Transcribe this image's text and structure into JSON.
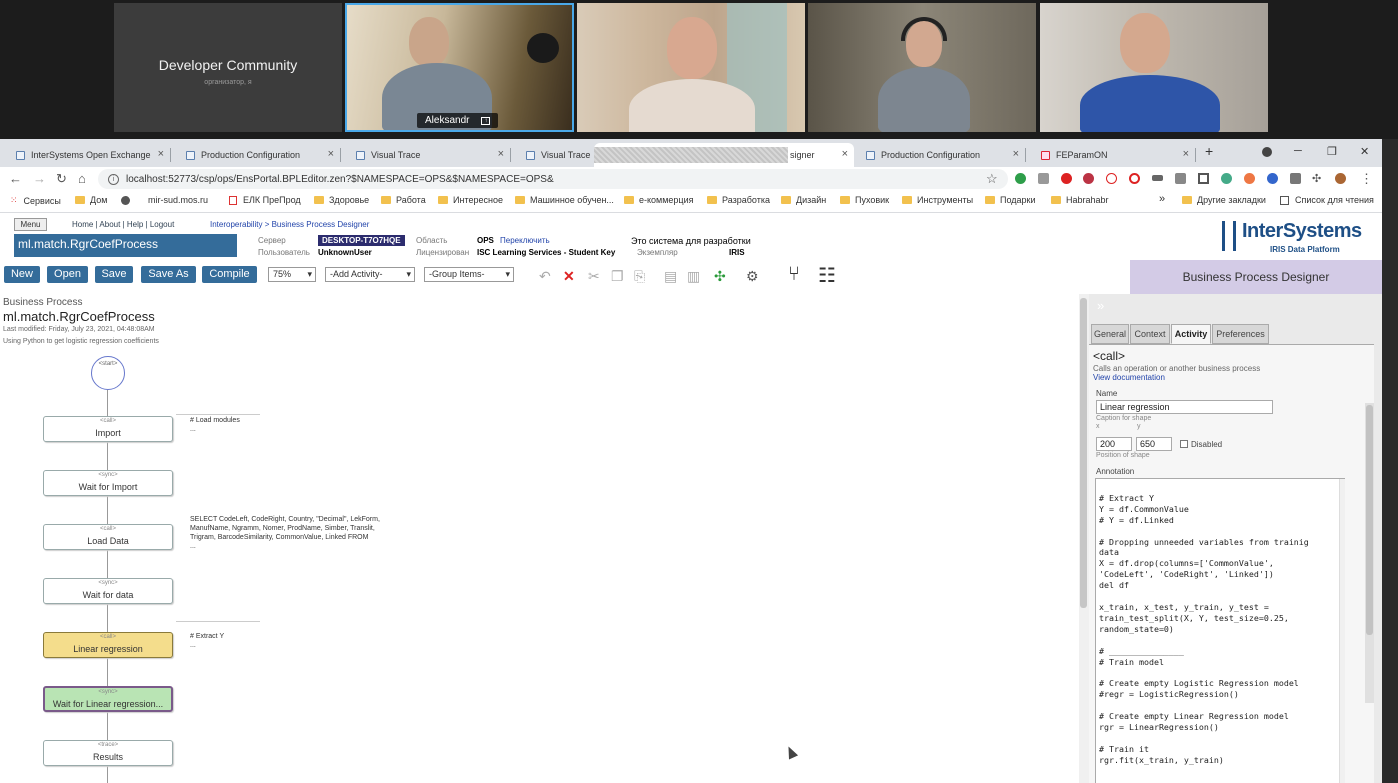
{
  "meeting": {
    "host_tile": {
      "name": "Developer Community",
      "subtitle": "организатор, я"
    },
    "active_speaker": {
      "name": "Aleksandr",
      "icon": "share-screen-icon"
    }
  },
  "browser": {
    "tabs": [
      {
        "title": "InterSystems Open Exchange"
      },
      {
        "title": "Production Configuration"
      },
      {
        "title": "Visual Trace"
      },
      {
        "title": "Visual Trace"
      },
      {
        "title": "signer"
      },
      {
        "title": "Production Configuration"
      },
      {
        "title": "FEParamON"
      }
    ],
    "new_tab": "+",
    "url": "localhost:52773/csp/ops/EnsPortal.BPLEditor.zen?$NAMESPACE=OPS&$NAMESPACE=OPS&",
    "bookmarks": [
      {
        "label": "Сервисы"
      },
      {
        "label": "Дом"
      },
      {
        "label": "mir-sud.mos.ru"
      },
      {
        "label": "ЕЛК ПреПрод"
      },
      {
        "label": "Здоровье"
      },
      {
        "label": "Работа"
      },
      {
        "label": "Интересное"
      },
      {
        "label": "Машинное обучен..."
      },
      {
        "label": "е-коммерция"
      },
      {
        "label": "Разработка"
      },
      {
        "label": "Дизайн"
      },
      {
        "label": "Пуховик"
      },
      {
        "label": "Инструменты"
      },
      {
        "label": "Подарки"
      },
      {
        "label": "Habrahabr"
      }
    ],
    "bookmarks_more": "»",
    "other_bookmarks": "Другие закладки",
    "reading_list": "Список для чтения"
  },
  "portal": {
    "menu_label": "Menu",
    "top_links": "Home | About | Help | Logout",
    "breadcrumb": "Interoperability > Business Process Designer",
    "class_name": "ml.match.RgrCoefProcess",
    "server_label": "Сервер",
    "server_value": "DESKTOP-T7O7HQE",
    "user_label": "Пользователь",
    "user_value": "UnknownUser",
    "namespace_label": "Область",
    "namespace_value": "OPS",
    "switch_link": "Переключить",
    "license_label": "Лицензирован",
    "license_value": "ISC Learning Services - Student Key",
    "system_note": "Это система для разработки",
    "instance_label": "Экземпляр",
    "instance_value": "IRIS",
    "logo_main": "InterSystems",
    "logo_sub": "IRIS Data Platform",
    "page_title": "Business Process Designer"
  },
  "toolbar": {
    "new": "New",
    "open": "Open",
    "save": "Save",
    "save_as": "Save As",
    "compile": "Compile",
    "zoom": "75%",
    "add_activity": "-Add Activity-",
    "group_items": "-Group Items-"
  },
  "process": {
    "type_label": "Business Process",
    "name": "ml.match.RgrCoefProcess",
    "modified": "Last modified: Friday, July 23, 2021, 04:48:08AM",
    "description": "Using Python to get logistic regression coefficients",
    "start": "<start>",
    "shapes": [
      {
        "kind": "<call>",
        "caption": "Import"
      },
      {
        "kind": "<sync>",
        "caption": "Wait for Import"
      },
      {
        "kind": "<call>",
        "caption": "Load Data"
      },
      {
        "kind": "<sync>",
        "caption": "Wait for data"
      },
      {
        "kind": "<call>",
        "caption": "Linear regression"
      },
      {
        "kind": "<sync>",
        "caption": "Wait for Linear regression..."
      },
      {
        "kind": "<trace>",
        "caption": "Results"
      }
    ],
    "annotations": {
      "import": "# Load modules\n...",
      "load": "SELECT CodeLeft, CodeRight, Country, \"Decimal\", LekForm,\nManufName, Ngramm, Nomer, ProdName, Simber, Translit,\nTrigram, BarcodeSimilarity, CommonValue, Linked FROM\n...",
      "linear": "# Extract Y\n..."
    }
  },
  "panel": {
    "collapse": "»",
    "tabs": [
      "General",
      "Context",
      "Activity",
      "Preferences"
    ],
    "active_tab": "Activity",
    "header": "<call>",
    "description": "Calls an operation or another business process",
    "doc_link": "View documentation",
    "name_label": "Name",
    "name_value": "Linear regression",
    "name_hint": "Caption for shape",
    "x_label": "x",
    "y_label": "y",
    "x_value": "200",
    "y_value": "650",
    "disabled_label": "Disabled",
    "pos_hint": "Position of shape",
    "annotation_label": "Annotation",
    "annotation_text": "\n# Extract Y\nY = df.CommonValue\n# Y = df.Linked\n\n# Dropping unneeded variables from trainig\ndata\nX = df.drop(columns=['CommonValue',\n'CodeLeft', 'CodeRight', 'Linked'])\ndel df\n\nx_train, x_test, y_train, y_test =\ntrain_test_split(X, Y, test_size=0.25,\nrandom_state=0)\n\n# _______________\n# Train model\n\n# Create empty Logistic Regression model\n#regr = LogisticRegression()\n\n# Create empty Linear Regression model\nrgr = LinearRegression()\n\n# Train it\nrgr.fit(x_train, y_train)"
  }
}
